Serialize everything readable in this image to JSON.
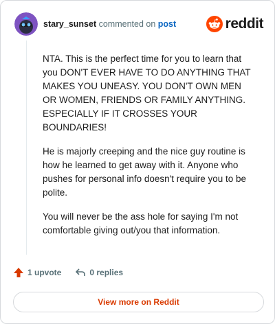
{
  "comment": {
    "username": "stary_sunset",
    "action_text": "commented on",
    "post_link": "post",
    "paragraphs": [
      "NTA. This is the perfect time for you to learn that you DON'T EVER HAVE TO DO ANYTHING THAT MAKES YOU UNEASY. YOU DON'T OWN MEN OR WOMEN, FRIENDS OR FAMILY ANYTHING. ESPECIALLY IF IT CROSSES YOUR BOUNDARIES!",
      "He is majorly creeping and the nice guy routine is how he learned to get away with it. Anyone who pushes for personal info doesn't require you to be polite.",
      "You will never be the ass hole for saying I'm not comfortable giving out/you that information."
    ]
  },
  "brand": {
    "name": "reddit",
    "color": "#ff4500"
  },
  "actions": {
    "upvotes": "1 upvote",
    "replies": "0 replies"
  },
  "footer": {
    "view_more": "View more on Reddit"
  },
  "colors": {
    "accent": "#ff4500",
    "link": "#0a66c2",
    "muted": "#576f76"
  }
}
